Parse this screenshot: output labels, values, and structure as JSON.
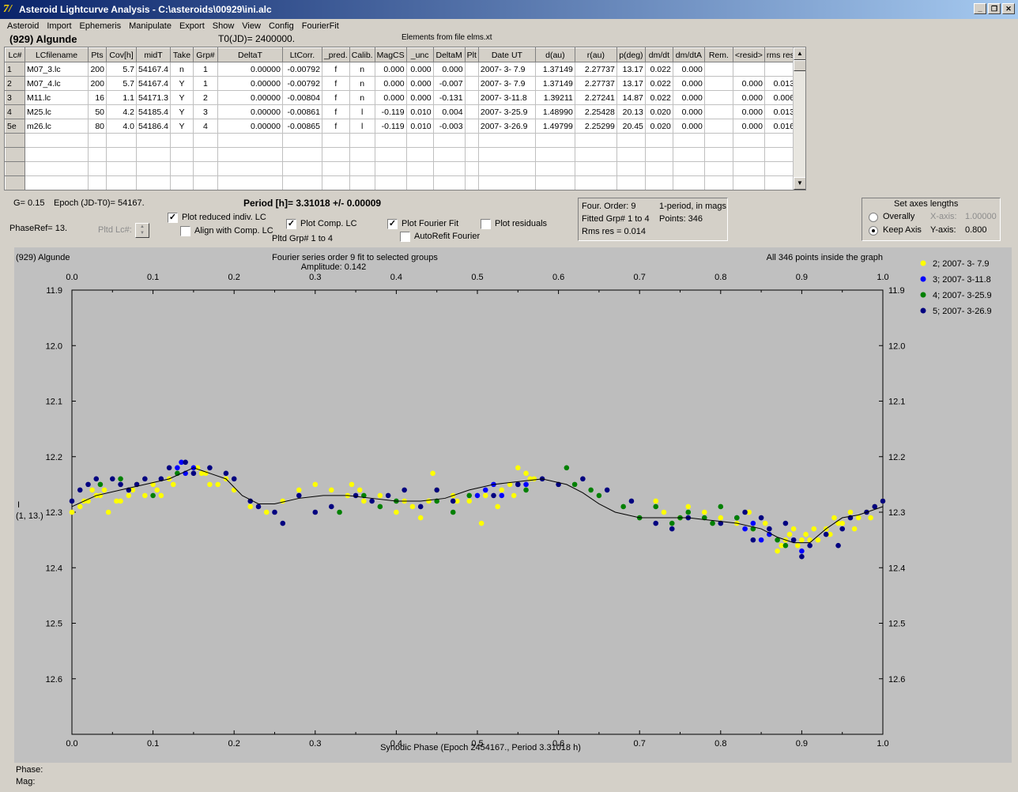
{
  "window": {
    "title": "Asteroid Lightcurve Analysis - C:\\asteroids\\00929\\ini.alc",
    "icon": "app-icon",
    "buttons": [
      "minimize-icon",
      "restore-icon",
      "close-icon"
    ]
  },
  "menu": [
    "Asteroid",
    "Import",
    "Ephemeris",
    "Manipulate",
    "Export",
    "Show",
    "View",
    "Config",
    "FourierFit"
  ],
  "header": {
    "asteroid": "(929) Algunde",
    "t0": "T0(JD)= 2400000.",
    "elements": "Elements from file elms.xt"
  },
  "table": {
    "columns": [
      "Lc#",
      "LCfilename",
      "Pts",
      "Cov[h]",
      "midT",
      "Take",
      "Grp#",
      "DeltaT",
      "LtCorr.",
      "_pred.",
      "Calib.",
      "MagCS",
      "_unc",
      "DeltaM",
      "Plt",
      "Date UT",
      "d(au)",
      "r(au)",
      "p(deg)",
      "dm/dt",
      "dm/dtA",
      "Rem.",
      "<resid>",
      "rms res"
    ],
    "rows": [
      [
        "1",
        "M07_3.lc",
        "200",
        "5.7",
        "54167.4",
        "n",
        "1",
        "0.00000",
        "-0.00792",
        "f",
        "n",
        "0.000",
        "0.000",
        "0.000",
        "",
        "2007- 3- 7.9",
        "1.37149",
        "2.27737",
        "13.17",
        "0.022",
        "0.000",
        "",
        "",
        ""
      ],
      [
        "2",
        "M07_4.lc",
        "200",
        "5.7",
        "54167.4",
        "Y",
        "1",
        "0.00000",
        "-0.00792",
        "f",
        "n",
        "0.000",
        "0.000",
        "-0.007",
        "",
        "2007- 3- 7.9",
        "1.37149",
        "2.27737",
        "13.17",
        "0.022",
        "0.000",
        "",
        "0.000",
        "0.013"
      ],
      [
        "3",
        "M11.lc",
        "16",
        "1.1",
        "54171.3",
        "Y",
        "2",
        "0.00000",
        "-0.00804",
        "f",
        "n",
        "0.000",
        "0.000",
        "-0.131",
        "",
        "2007- 3-11.8",
        "1.39211",
        "2.27241",
        "14.87",
        "0.022",
        "0.000",
        "",
        "0.000",
        "0.006"
      ],
      [
        "4",
        "M25.lc",
        "50",
        "4.2",
        "54185.4",
        "Y",
        "3",
        "0.00000",
        "-0.00861",
        "f",
        "l",
        "-0.119",
        "0.010",
        "0.004",
        "",
        "2007- 3-25.9",
        "1.48990",
        "2.25428",
        "20.13",
        "0.020",
        "0.000",
        "",
        "0.000",
        "0.013"
      ],
      [
        "5e",
        "m26.lc",
        "80",
        "4.0",
        "54186.4",
        "Y",
        "4",
        "0.00000",
        "-0.00865",
        "f",
        "l",
        "-0.119",
        "0.010",
        "-0.003",
        "",
        "2007- 3-26.9",
        "1.49799",
        "2.25299",
        "20.45",
        "0.020",
        "0.000",
        "",
        "0.000",
        "0.016"
      ]
    ],
    "empty_rows": 4
  },
  "controls": {
    "g": "G= 0.15",
    "epoch": "Epoch (JD-T0)= 54167.",
    "period": "Period [h]= 3.31018 +/- 0.00009",
    "phaseref": "PhaseRef= 13.",
    "pltd_lc": "Pltd Lc#:",
    "plot_reduced": "Plot reduced indiv. LC",
    "align_comp": "Align with Comp. LC",
    "plot_comp": "Plot Comp. LC",
    "pltd_grp": "Pltd Grp#  1   to   4",
    "plot_fourier": "Plot Fourier Fit",
    "autorefit": "AutoRefit Fourier",
    "plot_residuals": "Plot residuals"
  },
  "checkboxes": {
    "plot_reduced": true,
    "align_comp": false,
    "plot_comp": true,
    "plot_fourier": true,
    "autorefit": false,
    "plot_residuals": false
  },
  "fourier_info": {
    "order": "Four. Order:  9",
    "mode": "1-period, in mags",
    "fitted": "Fitted Grp# 1 to 4",
    "points": "Points: 346",
    "rms": "Rms res      = 0.014"
  },
  "axes_box": {
    "title": "Set axes lengths",
    "overally": "Overally",
    "keep": "Keep Axis",
    "xaxis_label": "X-axis:",
    "xaxis_value": "1.00000",
    "yaxis_label": "Y-axis:",
    "yaxis_value": "0.800",
    "selected": "keep"
  },
  "plot": {
    "name": "(929) Algunde",
    "subtitle": "Fourier series order 9 fit to selected groups",
    "amplitude": "Amplitude: 0.142",
    "points_note": "All 346 points inside the graph",
    "ylabel_line1": "I",
    "ylabel_line2": "(1, 13.)"
  },
  "status": {
    "phase": "Phase:",
    "mag": "Mag:"
  },
  "chart_data": {
    "type": "scatter",
    "xlabel": "Synodic Phase (Epoch 2454167., Period 3.31018 h)",
    "ylabel": "I",
    "xlim": [
      0,
      1
    ],
    "ylim": [
      12.7,
      11.9
    ],
    "y_inverted": true,
    "x_ticks": [
      "0.0",
      "0.1",
      "0.2",
      "0.3",
      "0.4",
      "0.5",
      "0.6",
      "0.7",
      "0.8",
      "0.9",
      "1.0"
    ],
    "y_ticks": [
      "11.9",
      "12.0",
      "12.1",
      "12.2",
      "12.3",
      "12.4",
      "12.5",
      "12.6"
    ],
    "legend_position": "right",
    "fit_curve": {
      "x": [
        0.0,
        0.03,
        0.06,
        0.09,
        0.12,
        0.15,
        0.17,
        0.19,
        0.21,
        0.23,
        0.25,
        0.28,
        0.31,
        0.34,
        0.37,
        0.4,
        0.43,
        0.46,
        0.49,
        0.52,
        0.55,
        0.58,
        0.61,
        0.63,
        0.65,
        0.67,
        0.7,
        0.73,
        0.76,
        0.79,
        0.82,
        0.85,
        0.87,
        0.89,
        0.91,
        0.93,
        0.95,
        0.97,
        1.0
      ],
      "y": [
        12.29,
        12.27,
        12.26,
        12.25,
        12.24,
        12.22,
        12.23,
        12.24,
        12.27,
        12.285,
        12.285,
        12.275,
        12.27,
        12.27,
        12.275,
        12.28,
        12.28,
        12.275,
        12.26,
        12.25,
        12.245,
        12.24,
        12.25,
        12.265,
        12.285,
        12.3,
        12.31,
        12.31,
        12.31,
        12.315,
        12.32,
        12.33,
        12.345,
        12.355,
        12.355,
        12.33,
        12.31,
        12.305,
        12.29
      ]
    },
    "series": [
      {
        "name": "2; 2007- 3- 7.9",
        "color": "#ffff00",
        "x": [
          0.0,
          0.01,
          0.02,
          0.03,
          0.04,
          0.045,
          0.06,
          0.07,
          0.08,
          0.09,
          0.1,
          0.11,
          0.12,
          0.14,
          0.16,
          0.17,
          0.18,
          0.19,
          0.2,
          0.22,
          0.24,
          0.26,
          0.28,
          0.3,
          0.32,
          0.34,
          0.36,
          0.38,
          0.4,
          0.41,
          0.42,
          0.43,
          0.44,
          0.45,
          0.47,
          0.49,
          0.51,
          0.53,
          0.54,
          0.55,
          0.56,
          0.57,
          0.72,
          0.73,
          0.75,
          0.76,
          0.78,
          0.8,
          0.82,
          0.84,
          0.86,
          0.87,
          0.88,
          0.89,
          0.9,
          0.905,
          0.91,
          0.92,
          0.93,
          0.94,
          0.95,
          0.96,
          0.97,
          0.98,
          0.99,
          1.0,
          0.015,
          0.025,
          0.035,
          0.055,
          0.075,
          0.105,
          0.125,
          0.155,
          0.165,
          0.345,
          0.355,
          0.445,
          0.475,
          0.505,
          0.525,
          0.545,
          0.565,
          0.835,
          0.855,
          0.875,
          0.885,
          0.895,
          0.915,
          0.935,
          0.945,
          0.965,
          0.985
        ],
        "y": [
          12.3,
          12.29,
          12.28,
          12.27,
          12.26,
          12.3,
          12.28,
          12.27,
          12.25,
          12.27,
          12.25,
          12.27,
          12.24,
          12.23,
          12.23,
          12.25,
          12.25,
          12.24,
          12.26,
          12.29,
          12.3,
          12.28,
          12.26,
          12.25,
          12.26,
          12.27,
          12.28,
          12.27,
          12.3,
          12.28,
          12.29,
          12.31,
          12.28,
          12.26,
          12.27,
          12.28,
          12.27,
          12.26,
          12.25,
          12.22,
          12.23,
          12.24,
          12.28,
          12.3,
          12.31,
          12.29,
          12.3,
          12.31,
          12.32,
          12.33,
          12.34,
          12.37,
          12.35,
          12.33,
          12.35,
          12.34,
          12.35,
          12.35,
          12.33,
          12.31,
          12.32,
          12.3,
          12.31,
          12.3,
          12.29,
          12.28,
          12.28,
          12.26,
          12.27,
          12.28,
          12.26,
          12.26,
          12.25,
          12.22,
          12.23,
          12.25,
          12.26,
          12.23,
          12.28,
          12.32,
          12.29,
          12.27,
          12.24,
          12.3,
          12.32,
          12.36,
          12.34,
          12.36,
          12.33,
          12.34,
          12.32,
          12.33,
          12.31
        ]
      },
      {
        "name": "3; 2007- 3-11.8",
        "color": "#0000ff",
        "x": [
          0.13,
          0.135,
          0.14,
          0.15,
          0.5,
          0.51,
          0.52,
          0.53,
          0.55,
          0.56,
          0.82,
          0.83,
          0.84,
          0.85,
          0.86,
          0.9
        ],
        "y": [
          12.22,
          12.21,
          12.23,
          12.22,
          12.27,
          12.26,
          12.25,
          12.27,
          12.25,
          12.25,
          12.31,
          12.33,
          12.32,
          12.35,
          12.34,
          12.37
        ]
      },
      {
        "name": "4; 2007- 3-25.9",
        "color": "#008000",
        "x": [
          0.035,
          0.06,
          0.1,
          0.13,
          0.33,
          0.36,
          0.38,
          0.4,
          0.45,
          0.47,
          0.49,
          0.56,
          0.61,
          0.62,
          0.64,
          0.65,
          0.68,
          0.7,
          0.72,
          0.74,
          0.75,
          0.76,
          0.78,
          0.79,
          0.8,
          0.82,
          0.84,
          0.87,
          0.88
        ],
        "y": [
          12.25,
          12.24,
          12.27,
          12.23,
          12.3,
          12.27,
          12.29,
          12.28,
          12.28,
          12.3,
          12.27,
          12.26,
          12.22,
          12.25,
          12.26,
          12.27,
          12.29,
          12.31,
          12.29,
          12.32,
          12.31,
          12.3,
          12.31,
          12.32,
          12.29,
          12.31,
          12.33,
          12.35,
          12.36
        ]
      },
      {
        "name": "5; 2007- 3-26.9",
        "color": "#000080",
        "x": [
          0.0,
          0.01,
          0.02,
          0.03,
          0.05,
          0.06,
          0.07,
          0.08,
          0.09,
          0.11,
          0.12,
          0.14,
          0.15,
          0.17,
          0.19,
          0.2,
          0.22,
          0.23,
          0.25,
          0.26,
          0.28,
          0.3,
          0.32,
          0.35,
          0.37,
          0.39,
          0.41,
          0.43,
          0.45,
          0.47,
          0.52,
          0.55,
          0.58,
          0.6,
          0.63,
          0.66,
          0.69,
          0.72,
          0.74,
          0.76,
          0.8,
          0.83,
          0.85,
          0.86,
          0.88,
          0.89,
          0.91,
          0.93,
          0.95,
          0.96,
          0.98,
          0.99,
          1.0,
          0.84,
          0.9,
          0.945
        ],
        "y": [
          12.28,
          12.26,
          12.25,
          12.24,
          12.24,
          12.25,
          12.26,
          12.25,
          12.24,
          12.24,
          12.22,
          12.21,
          12.23,
          12.22,
          12.23,
          12.24,
          12.28,
          12.29,
          12.3,
          12.32,
          12.27,
          12.3,
          12.29,
          12.27,
          12.28,
          12.27,
          12.26,
          12.29,
          12.26,
          12.28,
          12.27,
          12.25,
          12.24,
          12.25,
          12.24,
          12.26,
          12.28,
          12.32,
          12.33,
          12.31,
          12.32,
          12.3,
          12.31,
          12.33,
          12.32,
          12.35,
          12.36,
          12.34,
          12.33,
          12.31,
          12.3,
          12.29,
          12.28,
          12.35,
          12.38,
          12.36
        ]
      }
    ]
  }
}
